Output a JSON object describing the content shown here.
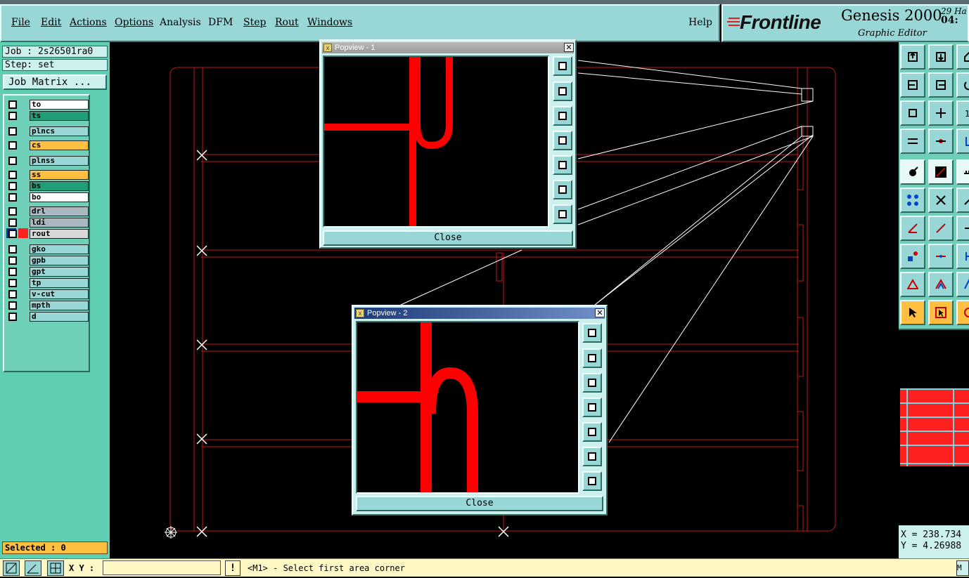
{
  "menubar": {
    "items": [
      "File",
      "Edit",
      "Actions",
      "Options",
      "Analysis",
      "DFM",
      "Step",
      "Rout",
      "Windows"
    ],
    "help": "Help"
  },
  "brand": {
    "logo": "Frontline",
    "product": "Genesis 2000",
    "subtitle": "Graphic Editor",
    "date_line1": "29 Ha",
    "date_line2": "04:"
  },
  "left_panel": {
    "job": "Job : 2s26501ra0",
    "step": "Step: set",
    "job_matrix_button": "Job Matrix ...",
    "layers": [
      {
        "name": "to",
        "color": "#ffffff"
      },
      {
        "name": "ts",
        "color": "#1f9e77"
      },
      {
        "name": "plncs",
        "color": "#99d6d6"
      },
      {
        "name": "cs",
        "color": "#ffbf40"
      },
      {
        "name": "plnss",
        "color": "#99d6d6"
      },
      {
        "name": "ss",
        "color": "#ffbf40"
      },
      {
        "name": "bs",
        "color": "#1f9e77"
      },
      {
        "name": "bo",
        "color": "#ffffff"
      },
      {
        "name": "drl",
        "color": "#a9b7be"
      },
      {
        "name": "ldi",
        "color": "#a9b7be"
      },
      {
        "name": "rout",
        "color": "#d8d8d8"
      },
      {
        "name": "gko",
        "color": "#99d6d6"
      },
      {
        "name": "gpb",
        "color": "#99d6d6"
      },
      {
        "name": "gpt",
        "color": "#99d6d6"
      },
      {
        "name": "tp",
        "color": "#99d6d6"
      },
      {
        "name": "v-cut",
        "color": "#99d6d6"
      },
      {
        "name": "mpth",
        "color": "#99d6d6"
      },
      {
        "name": "d",
        "color": "#99d6d6"
      }
    ],
    "selected": "Selected : 0"
  },
  "popview1": {
    "title": "Popview - 1",
    "close_label": "Close"
  },
  "popview2": {
    "title": "Popview - 2",
    "close_label": "Close"
  },
  "coords": {
    "x": "X = 238.734",
    "y": "Y = 4.26988"
  },
  "statusbar": {
    "xy_label": "X Y :",
    "xy_value": "",
    "warn": "!",
    "prompt": "<M1> - Select first area corner",
    "right": "M"
  },
  "colors": {
    "accent_red": "#ff0000",
    "panel_cyan": "#99d6d6",
    "panel_green": "#5fcfb4"
  }
}
